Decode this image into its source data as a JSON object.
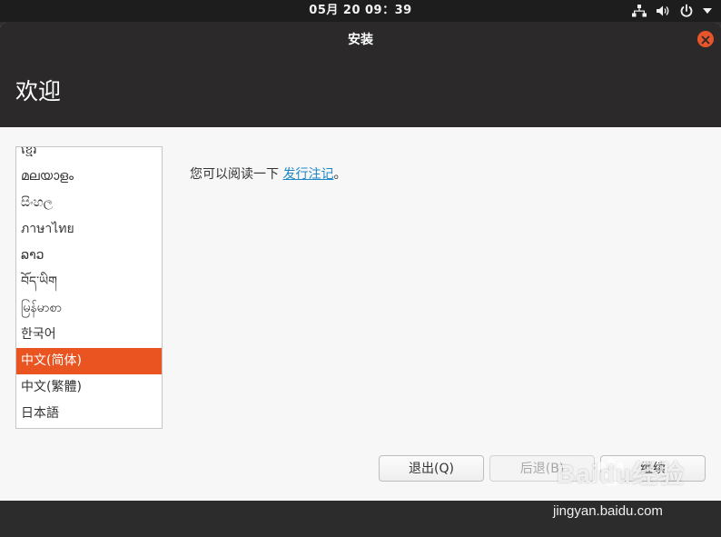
{
  "topbar": {
    "clock": "05月 20  09：39",
    "icons": [
      "network-icon",
      "volume-icon",
      "power-icon",
      "chevron-down-icon"
    ]
  },
  "window": {
    "title": "安装",
    "page_title": "欢迎"
  },
  "languages": {
    "items": [
      "ខ្មែរ",
      "മലയാളം",
      "සිංහල",
      "ภาษาไทย",
      "ລາວ",
      "བོད་ཡིག",
      "မြန်မာစာ",
      "한국어",
      "中文(简体)",
      "中文(繁體)",
      "日本語"
    ],
    "selected": "中文(简体)"
  },
  "main": {
    "release_text": "您可以阅读一下 ",
    "release_link": "发行注记",
    "release_suffix": "。"
  },
  "buttons": {
    "quit": "退出(Q)",
    "back": "后退(B)",
    "continue": "继续"
  },
  "watermark": {
    "logo": "Baidu经验",
    "url": "jingyan.baidu.com"
  },
  "colors": {
    "accent": "#e95420",
    "link": "#1e88c7",
    "header": "#2b2929"
  }
}
